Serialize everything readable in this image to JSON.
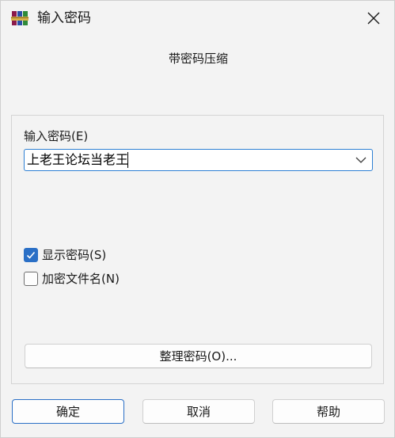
{
  "window": {
    "title": "输入密码",
    "close_icon": "close-icon",
    "app_icon": "winrar-books-icon"
  },
  "dialog": {
    "heading": "带密码压缩",
    "password_label": "输入密码(E)",
    "password_value": "上老王论坛当老王",
    "dropdown_icon": "chevron-down-icon",
    "show_password": {
      "label": "显示密码(S)",
      "checked": true
    },
    "encrypt_filenames": {
      "label": "加密文件名(N)",
      "checked": false
    },
    "manage_button": "整理密码(O)..."
  },
  "buttons": {
    "ok": "确定",
    "cancel": "取消",
    "help": "帮助"
  },
  "colors": {
    "accent": "#2a6fc6",
    "window_bg": "#f3f3f3",
    "input_border": "#2d7fd3"
  }
}
